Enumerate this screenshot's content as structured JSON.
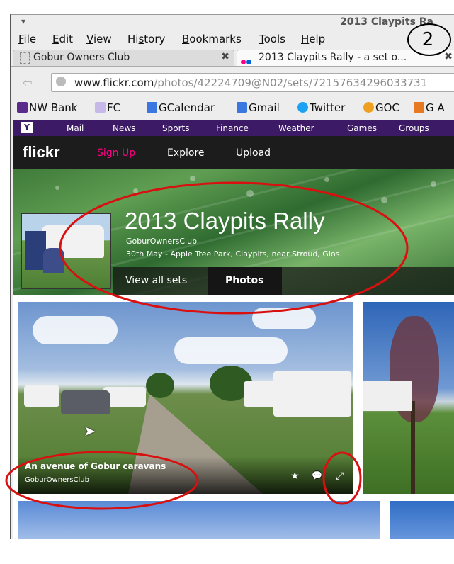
{
  "window": {
    "title": "2013 Claypits Ra",
    "annotation_number": "2"
  },
  "menu": [
    "File",
    "Edit",
    "View",
    "History",
    "Bookmarks",
    "Tools",
    "Help"
  ],
  "menu_mnemonics": [
    "F",
    "E",
    "V",
    "s",
    "B",
    "T",
    "H"
  ],
  "tabs": [
    {
      "label": "Gobur Owners Club",
      "close": "✖"
    },
    {
      "label": "2013 Claypits Rally - a set o...",
      "close": "✖"
    }
  ],
  "nav": {
    "back": "⇦",
    "url_domain": "www.flickr.com",
    "url_path": "/photos/42224709@N02/sets/72157634296033731"
  },
  "bookmarks": [
    {
      "label": "NW Bank",
      "icon": "natwest-icon",
      "color": "#5b2b8c"
    },
    {
      "label": "FC",
      "icon": "fc-icon",
      "color": "#9b7fd0"
    },
    {
      "label": "GCalendar",
      "icon": "google-icon",
      "color": "#3b77e0"
    },
    {
      "label": "Gmail",
      "icon": "google-icon",
      "color": "#3b77e0"
    },
    {
      "label": "Twitter",
      "icon": "twitter-icon",
      "color": "#1da1f2"
    },
    {
      "label": "GOC",
      "icon": "goc-icon",
      "color": "#f0a020"
    },
    {
      "label": "G A",
      "icon": "ga-icon",
      "color": "#e87722"
    }
  ],
  "yahoo_nav": {
    "logo": "Y",
    "items": [
      "Mail",
      "News",
      "Sports",
      "Finance",
      "Weather",
      "Games",
      "Groups"
    ]
  },
  "flickr_nav": {
    "logo": "flickr",
    "signup": "Sign Up",
    "explore": "Explore",
    "upload": "Upload"
  },
  "set": {
    "title": "2013 Claypits Rally",
    "owner": "GoburOwnersClub",
    "description": "30th May - Apple Tree Park, Claypits, near Stroud, Glos.",
    "tabs": [
      "View all sets",
      "Photos"
    ],
    "active_tab": "Photos"
  },
  "photo": {
    "title": "An avenue of Gobur caravans",
    "owner": "GoburOwnersClub",
    "icons": {
      "favorite": "★",
      "comment": "💬",
      "expand": "⤢"
    }
  },
  "colors": {
    "yahoo_purple": "#3d1a66",
    "flickr_pink": "#ff0084",
    "annotation_red": "#d81010"
  }
}
